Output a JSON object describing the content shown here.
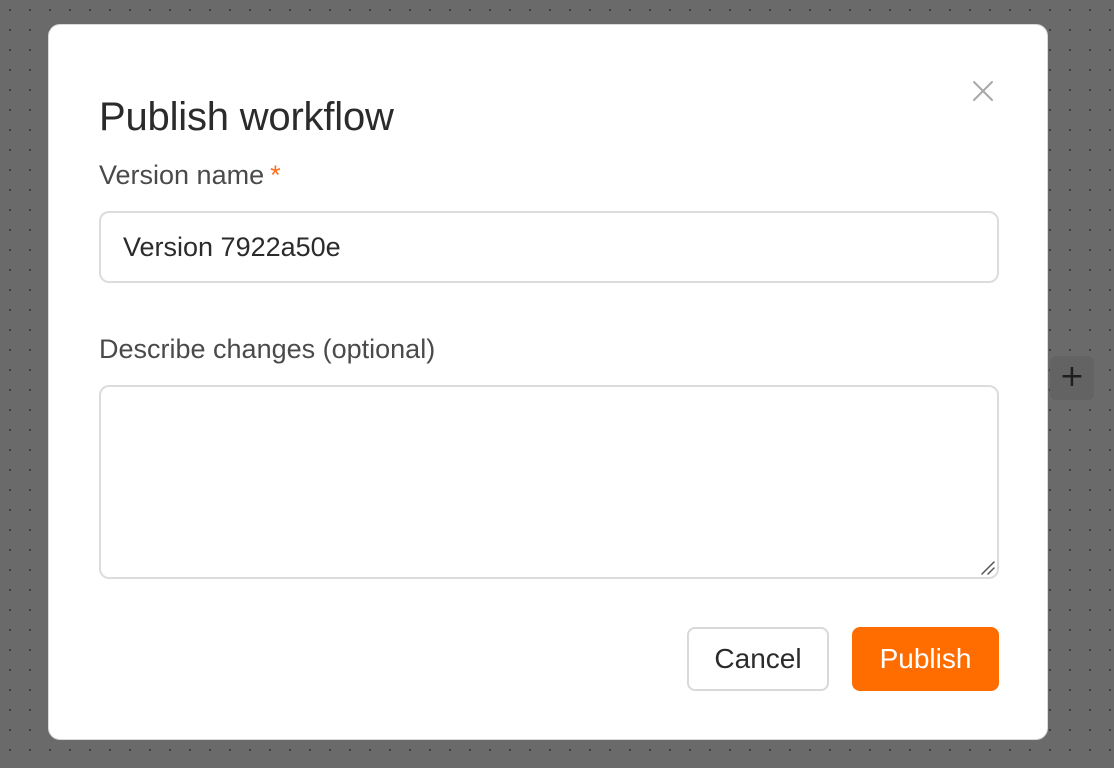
{
  "canvas": {
    "add_node_icon": "plus-icon",
    "add_node_glyph": "+"
  },
  "modal": {
    "title": "Publish workflow",
    "close_icon": "close-icon",
    "version_field": {
      "label": "Version name",
      "required_marker": "*",
      "value": "Version 7922a50e"
    },
    "description_field": {
      "label": "Describe changes (optional)",
      "value": ""
    },
    "actions": {
      "cancel_label": "Cancel",
      "publish_label": "Publish"
    }
  },
  "colors": {
    "accent": "#ff6d00",
    "required": "#ff6d1a",
    "overlay": "#6a6a6a"
  }
}
